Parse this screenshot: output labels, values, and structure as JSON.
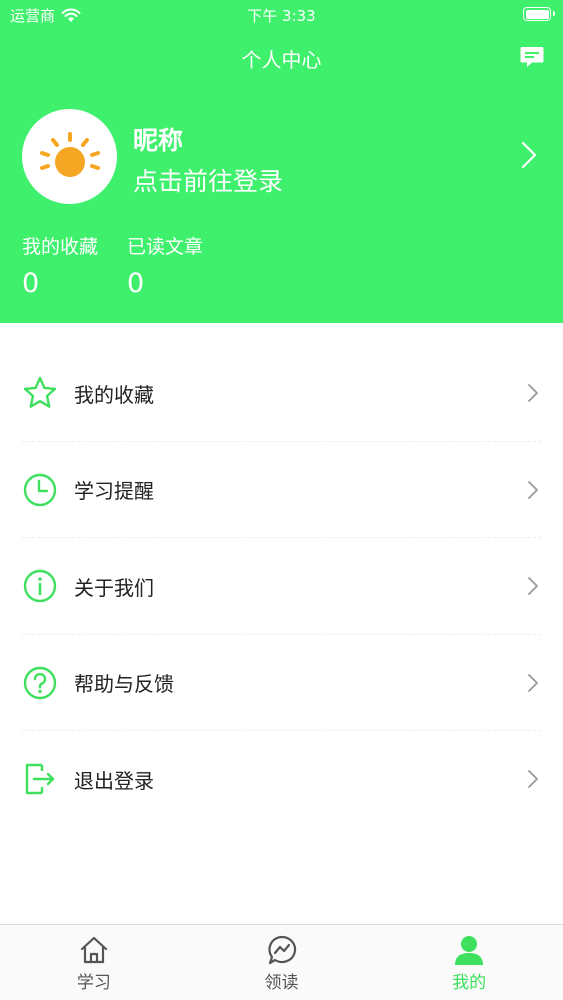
{
  "status_bar": {
    "carrier": "运营商",
    "time": "下午 3:33"
  },
  "header": {
    "title": "个人中心",
    "nickname": "昵称",
    "login_prompt": "点击前往登录",
    "stats": [
      {
        "label": "我的收藏",
        "value": "0"
      },
      {
        "label": "已读文章",
        "value": "0"
      }
    ]
  },
  "menu": {
    "items": [
      {
        "label": "我的收藏",
        "icon": "star-icon"
      },
      {
        "label": "学习提醒",
        "icon": "clock-icon"
      },
      {
        "label": "关于我们",
        "icon": "info-icon"
      },
      {
        "label": "帮助与反馈",
        "icon": "help-icon"
      },
      {
        "label": "退出登录",
        "icon": "logout-icon"
      }
    ]
  },
  "tab_bar": {
    "tabs": [
      {
        "label": "学习",
        "icon": "home-icon",
        "active": false
      },
      {
        "label": "领读",
        "icon": "chat-bubble-icon",
        "active": false
      },
      {
        "label": "我的",
        "icon": "user-icon",
        "active": true
      }
    ]
  },
  "colors": {
    "header_green": "#3ef06c",
    "icon_green": "#3ee05e",
    "sun_orange": "#f5a623"
  }
}
